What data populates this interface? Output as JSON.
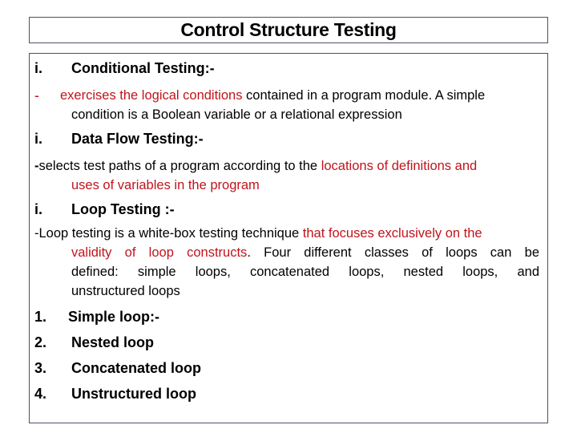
{
  "title": "Control Structure Testing",
  "sections": [
    {
      "marker": "i.",
      "heading": "Conditional Testing:-",
      "desc_marker": "-",
      "desc_red": "exercises the logical conditions",
      "desc_line1_rest": " contained in a program module. A simple",
      "desc_line2": "condition is a Boolean variable or a relational expression"
    },
    {
      "marker": "i.",
      "heading": "Data Flow Testing:-",
      "desc_dash": "-",
      "desc_line1_black": "selects test paths of a program according to the ",
      "desc_line1_red": "locations of definitions and",
      "desc_line2_red": "uses of variables in the program"
    },
    {
      "marker": "i.",
      "heading": "Loop Testing :-",
      "desc_line1_black": "-Loop testing is a white-box testing technique ",
      "desc_line1_red": "that focuses exclusively on the",
      "desc_line2_red": "validity of loop constructs",
      "desc_line2_black": ". Four different classes of loops can be",
      "desc_line3": "defined: simple loops, concatenated loops, nested loops, and",
      "desc_line4": "unstructured loops"
    }
  ],
  "loop_types": [
    {
      "num": "1.",
      "label": "Simple loop:-"
    },
    {
      "num": "2.",
      "label": "Nested loop"
    },
    {
      "num": "3.",
      "label": "Concatenated loop"
    },
    {
      "num": "4.",
      "label": "Unstructured loop"
    }
  ],
  "colors": {
    "highlight": "#c0141c",
    "border": "#5b4a66",
    "text": "#000000"
  }
}
